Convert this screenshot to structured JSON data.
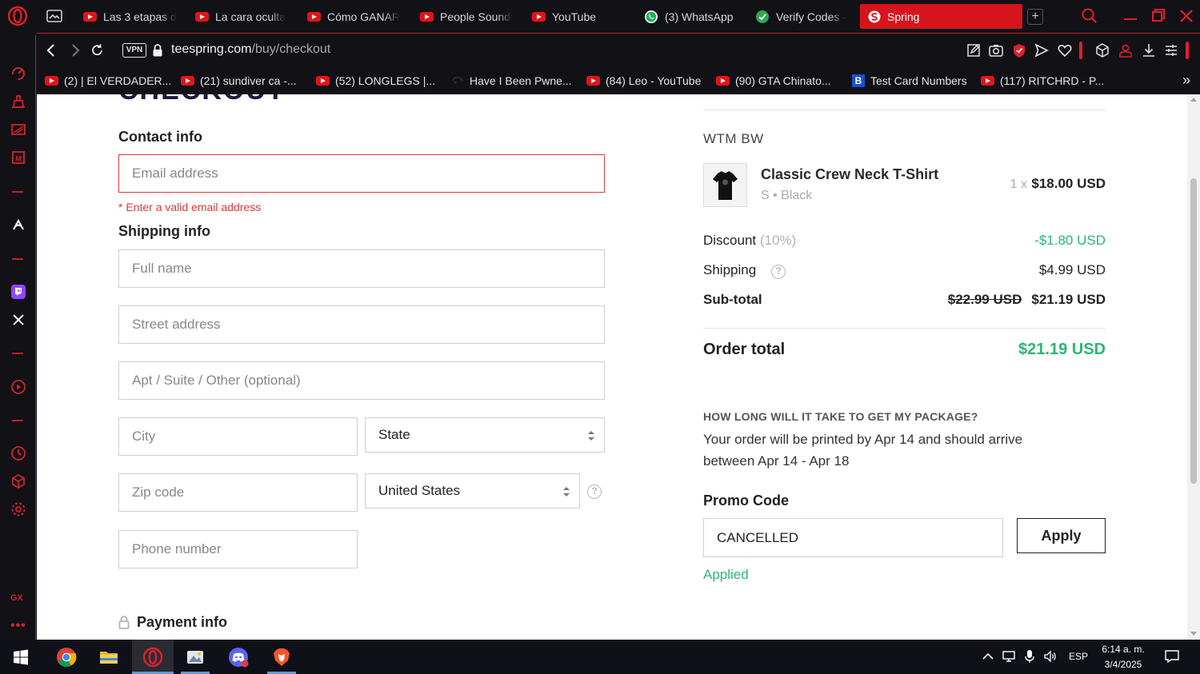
{
  "browser": {
    "tabs": [
      {
        "label": "Las 3 etapas d"
      },
      {
        "label": "La cara oculta"
      },
      {
        "label": "Cómo GANAR"
      },
      {
        "label": "People Soundi"
      },
      {
        "label": "YouTube"
      },
      {
        "label": "(3) WhatsApp"
      },
      {
        "label": "Verify Codes -"
      },
      {
        "label": "Spring"
      }
    ],
    "new_tab_label": "+",
    "vpn_label": "VPN",
    "url_host": "teespring.com",
    "url_path": "/buy/checkout",
    "bookmarks": [
      {
        "label": "(2) | El VERDADER..."
      },
      {
        "label": "(21) sundiver ca -..."
      },
      {
        "label": "(52) LONGLEGS |..."
      },
      {
        "label": "Have I Been Pwne..."
      },
      {
        "label": "(84) Leo - YouTube"
      },
      {
        "label": "(90) GTA Chinato..."
      },
      {
        "label": "Test Card Numbers",
        "icon_letter": "B"
      },
      {
        "label": "(117) RITCHRD - P..."
      }
    ],
    "bookmarks_more": "»",
    "sidebar": {
      "gx_label": "GX",
      "more_label": "•••"
    },
    "accent_color": "#d7141c"
  },
  "checkout": {
    "page_title_cut": "CHECKOUT",
    "contact_heading": "Contact info",
    "email_placeholder": "Email address",
    "email_error": "* Enter a valid email address",
    "shipping_heading": "Shipping info",
    "full_name_placeholder": "Full name",
    "street_placeholder": "Street address",
    "apt_placeholder": "Apt / Suite / Other (optional)",
    "city_placeholder": "City",
    "state_value": "State",
    "zip_placeholder": "Zip code",
    "country_value": "United States",
    "phone_placeholder": "Phone number",
    "help_glyph": "?",
    "payment_heading": "Payment info"
  },
  "summary": {
    "shop_name": "WTM BW",
    "product_name": "Classic Crew Neck T-Shirt",
    "product_variant": "S • Black",
    "quantity": "1 x",
    "product_price": "$18.00 USD",
    "discount_label": "Discount",
    "discount_pct": "(10%)",
    "discount_value": "-$1.80 USD",
    "shipping_label": "Shipping",
    "shipping_value": "$4.99 USD",
    "subtotal_label": "Sub-total",
    "subtotal_old": "$22.99 USD",
    "subtotal_value": "$21.19 USD",
    "total_label": "Order total",
    "total_value": "$21.19 USD",
    "faq_question": "HOW LONG WILL IT TAKE TO GET MY PACKAGE?",
    "faq_answer": "Your order will be printed by Apr 14 and should arrive between Apr 14 - Apr 18",
    "promo_label": "Promo Code",
    "promo_value": "CANCELLED",
    "apply_label": "Apply",
    "applied_label": "Applied",
    "green_color": "#2bb673"
  },
  "taskbar": {
    "language": "ESP",
    "time": "6:14 a. m.",
    "date": "3/4/2025"
  }
}
